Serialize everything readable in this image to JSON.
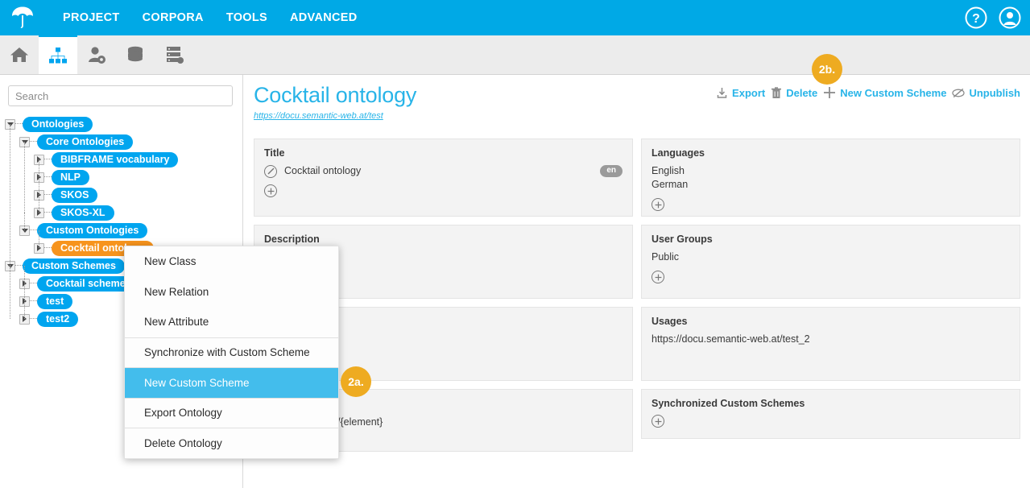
{
  "topbar": {
    "logo_icon": "umbrella-logo",
    "nav": [
      {
        "label": "PROJECT"
      },
      {
        "label": "CORPORA"
      },
      {
        "label": "TOOLS"
      },
      {
        "label": "ADVANCED"
      }
    ],
    "help_icon": "help-circle-icon",
    "account_icon": "user-circle-icon"
  },
  "iconbar": {
    "items": [
      {
        "icon": "home-icon",
        "active": false
      },
      {
        "icon": "ontology-hierarchy-icon",
        "active": true
      },
      {
        "icon": "user-settings-icon",
        "active": false
      },
      {
        "icon": "database-icon",
        "active": false
      },
      {
        "icon": "server-icon",
        "active": false
      }
    ]
  },
  "sidebar": {
    "search": {
      "placeholder": "Search",
      "value": ""
    },
    "tree": [
      {
        "label": "Ontologies",
        "depth": 0,
        "state": "expanded",
        "selected": false
      },
      {
        "label": "Core Ontologies",
        "depth": 1,
        "state": "expanded",
        "selected": false
      },
      {
        "label": "BIBFRAME vocabulary",
        "depth": 2,
        "state": "collapsed",
        "selected": false
      },
      {
        "label": "NLP",
        "depth": 2,
        "state": "collapsed",
        "selected": false
      },
      {
        "label": "SKOS",
        "depth": 2,
        "state": "collapsed",
        "selected": false
      },
      {
        "label": "SKOS-XL",
        "depth": 2,
        "state": "collapsed",
        "selected": false
      },
      {
        "label": "Custom Ontologies",
        "depth": 1,
        "state": "expanded",
        "selected": false
      },
      {
        "label": "Cocktail ontology",
        "depth": 2,
        "state": "collapsed",
        "selected": true
      },
      {
        "label": "Custom Schemes",
        "depth": 0,
        "state": "expanded",
        "selected": false
      },
      {
        "label": "Cocktail scheme",
        "depth": 1,
        "state": "collapsed",
        "selected": false
      },
      {
        "label": "test",
        "depth": 1,
        "state": "collapsed",
        "selected": false
      },
      {
        "label": "test2",
        "depth": 1,
        "state": "collapsed",
        "selected": false
      }
    ]
  },
  "main": {
    "title": "Cocktail ontology",
    "uri": "https://docu.semantic-web.at/test",
    "actions": [
      {
        "label": "Export",
        "icon": "export-download-icon"
      },
      {
        "label": "Delete",
        "icon": "trash-icon"
      },
      {
        "label": "New Custom Scheme",
        "icon": "plus-icon"
      },
      {
        "label": "Unpublish",
        "icon": "unpublish-crossed-icon"
      }
    ],
    "cards": {
      "title": {
        "header": "Title",
        "value": "Cocktail ontology",
        "lang": "en",
        "edit_icon": "edit-pencil-icon",
        "add_icon": "add-circle-icon"
      },
      "description": {
        "header": "Description"
      },
      "blank_card": {
        "header": ""
      },
      "uri_pattern": {
        "value": "antic-web.at/test/{element}"
      },
      "languages": {
        "header": "Languages",
        "values": [
          "English",
          "German"
        ],
        "add_icon": "add-circle-icon"
      },
      "user_groups": {
        "header": "User Groups",
        "values": [
          "Public"
        ],
        "add_icon": "add-circle-icon"
      },
      "usages": {
        "header": "Usages",
        "values": [
          "https://docu.semantic-web.at/test_2"
        ]
      },
      "synchronized_custom_schemes": {
        "header": "Synchronized Custom Schemes",
        "add_icon": "add-circle-icon"
      }
    }
  },
  "context_menu": {
    "items": [
      {
        "label": "New Class",
        "highlighted": false,
        "separator_above": false
      },
      {
        "label": "New Relation",
        "highlighted": false,
        "separator_above": false
      },
      {
        "label": "New Attribute",
        "highlighted": false,
        "separator_above": false
      },
      {
        "label": "Synchronize with Custom Scheme",
        "highlighted": false,
        "separator_above": true
      },
      {
        "label": "New Custom Scheme",
        "highlighted": true,
        "separator_above": true
      },
      {
        "label": "Export Ontology",
        "highlighted": false,
        "separator_above": true
      },
      {
        "label": "Delete Ontology",
        "highlighted": false,
        "separator_above": true
      }
    ]
  },
  "step_badges": [
    {
      "id": "2b",
      "label": "2b."
    },
    {
      "id": "2a",
      "label": "2a."
    }
  ],
  "colors": {
    "brand_blue": "#00a9e6",
    "link_blue": "#28b4e8",
    "pill_blue": "#00a5ef",
    "selected_orange": "#f7941d",
    "badge_orange": "#eeab21",
    "menu_highlight": "#43bdec",
    "card_bg": "#f3f3f3"
  }
}
